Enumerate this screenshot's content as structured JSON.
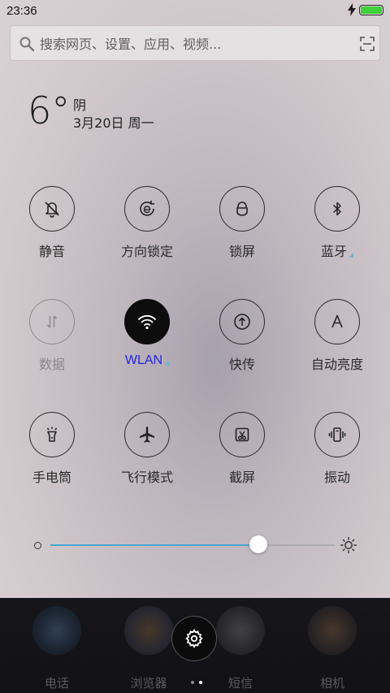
{
  "status_bar": {
    "time": "23:36",
    "battery_level": 1.0,
    "charging": true,
    "battery_color": "#3ed13a"
  },
  "search": {
    "placeholder": "搜索网页、设置、应用、视频..."
  },
  "weather": {
    "temperature": "6°",
    "condition": "阴",
    "date": "3月20日 周一"
  },
  "toggles": [
    {
      "id": "mute",
      "label": "静音",
      "icon": "bell-off-icon",
      "state": "normal"
    },
    {
      "id": "rotation-lock",
      "label": "方向锁定",
      "icon": "rotation-lock-icon",
      "state": "normal"
    },
    {
      "id": "lock-screen",
      "label": "锁屏",
      "icon": "lock-icon",
      "state": "normal"
    },
    {
      "id": "bluetooth",
      "label": "蓝牙",
      "icon": "bluetooth-icon",
      "state": "normal",
      "has_more": true
    },
    {
      "id": "mobile-data",
      "label": "数据",
      "icon": "data-arrows-icon",
      "state": "disabled"
    },
    {
      "id": "wlan",
      "label": "WLAN",
      "icon": "wifi-icon",
      "state": "on",
      "has_more": true
    },
    {
      "id": "quick-transfer",
      "label": "快传",
      "icon": "upload-icon",
      "state": "normal"
    },
    {
      "id": "auto-brightness",
      "label": "自动亮度",
      "icon": "letter-a-icon",
      "state": "normal"
    },
    {
      "id": "flashlight",
      "label": "手电筒",
      "icon": "flashlight-icon",
      "state": "normal"
    },
    {
      "id": "airplane-mode",
      "label": "飞行模式",
      "icon": "airplane-icon",
      "state": "normal"
    },
    {
      "id": "screenshot",
      "label": "截屏",
      "icon": "screenshot-icon",
      "state": "normal"
    },
    {
      "id": "vibrate",
      "label": "振动",
      "icon": "vibrate-icon",
      "state": "normal"
    }
  ],
  "brightness": {
    "level": 0.73,
    "accent_color": "#4aa6cf"
  },
  "dock": {
    "apps": [
      {
        "label": "电话",
        "icon": "phone-app-icon"
      },
      {
        "label": "浏览器",
        "icon": "browser-app-icon"
      },
      {
        "label": "短信",
        "icon": "messages-app-icon"
      },
      {
        "label": "相机",
        "icon": "camera-app-icon"
      }
    ],
    "settings_icon": "gear-icon",
    "page_count": 2,
    "current_page": 2
  },
  "colors": {
    "wlan_active_label": "#2323e6",
    "more_indicator": "#6fb6c8"
  }
}
